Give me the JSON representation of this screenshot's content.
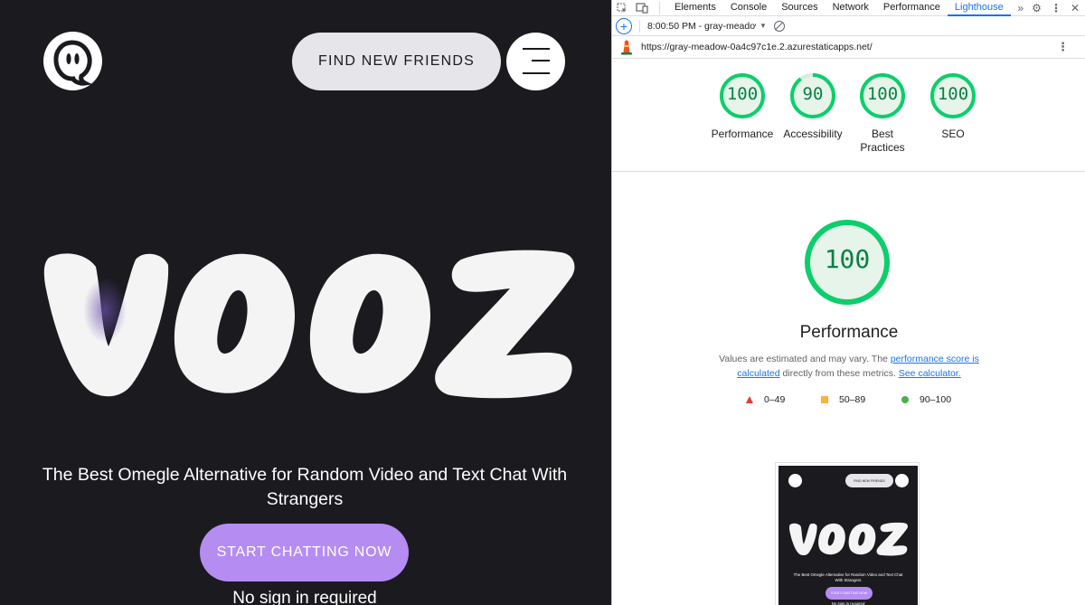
{
  "site": {
    "brand": "VOOZ",
    "find_button": "FIND NEW FRIENDS",
    "tagline": "The Best Omegle Alternative for Random Video and Text Chat With Strangers",
    "start_button": "START CHATTING NOW",
    "no_signin": "No sign in required",
    "colors": {
      "background": "#1b1a1f",
      "accent": "#b58cf2",
      "button_light": "#e6e6ea"
    }
  },
  "devtools": {
    "tabs": [
      "Elements",
      "Console",
      "Sources",
      "Network",
      "Performance",
      "Lighthouse"
    ],
    "active_tab": "Lighthouse",
    "report_select": "8:00:50 PM - gray-meadow",
    "url": "https://gray-meadow-0a4c97c1e.2.azurestaticapps.net/",
    "scores": [
      {
        "label": "Performance",
        "value": 100
      },
      {
        "label": "Accessibility",
        "value": 90
      },
      {
        "label": "Best Practices",
        "value": 100
      },
      {
        "label": "SEO",
        "value": 100
      }
    ],
    "performance": {
      "score": "100",
      "title": "Performance",
      "desc_prefix": "Values are estimated and may vary. The",
      "desc_link": "performance score is calculated",
      "desc_mid": "directly from these metrics.",
      "calc_link": "See calculator."
    },
    "legend": [
      {
        "range": "0–49",
        "color": "#e53935"
      },
      {
        "range": "50–89",
        "color": "#fbb13c"
      },
      {
        "range": "90–100",
        "color": "#4caf50"
      }
    ],
    "score_color": "#0b8043"
  }
}
